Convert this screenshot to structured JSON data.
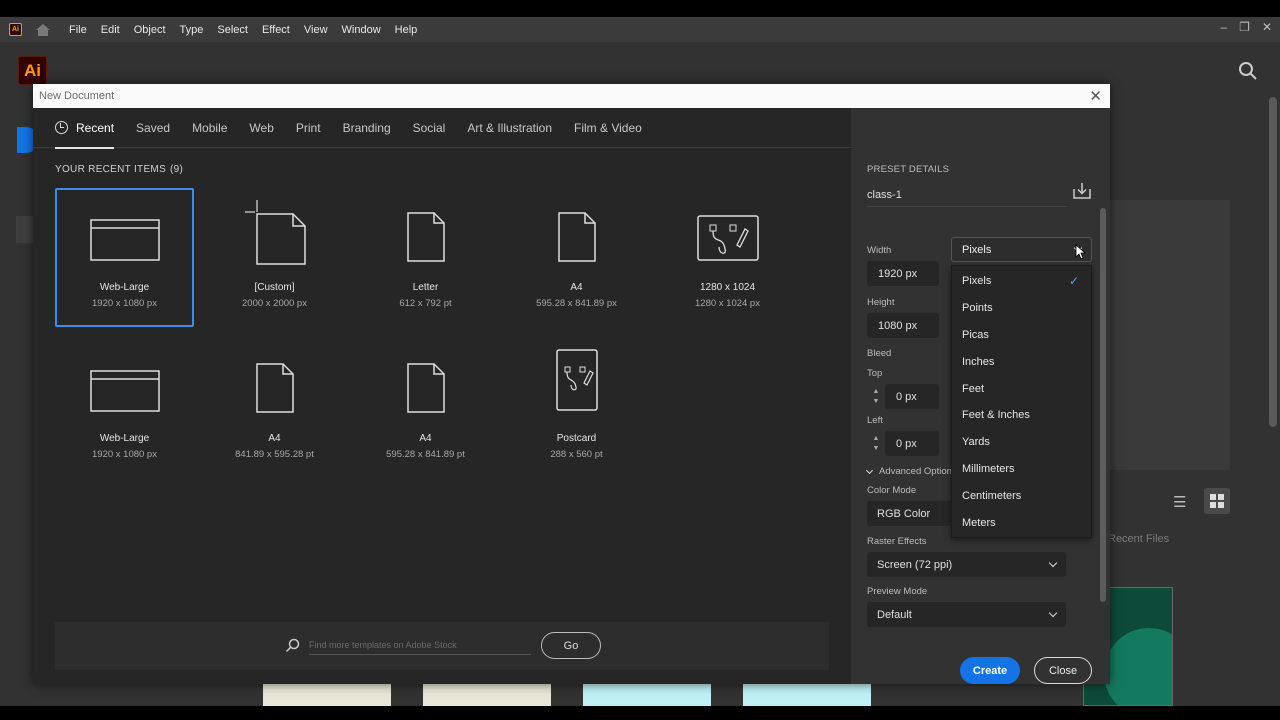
{
  "app": {
    "logo_small": "Ai",
    "logo_large": "Ai",
    "menu": [
      "File",
      "Edit",
      "Object",
      "Type",
      "Select",
      "Effect",
      "View",
      "Window",
      "Help"
    ],
    "window_controls": [
      "–",
      "❐",
      "✕"
    ],
    "background_recent_label": "Recent Files"
  },
  "dialog": {
    "title": "New Document",
    "close_glyph": "✕",
    "tabs": [
      {
        "label": "Recent",
        "active": true
      },
      {
        "label": "Saved"
      },
      {
        "label": "Mobile"
      },
      {
        "label": "Web"
      },
      {
        "label": "Print"
      },
      {
        "label": "Branding"
      },
      {
        "label": "Social"
      },
      {
        "label": "Art & Illustration"
      },
      {
        "label": "Film & Video"
      }
    ],
    "recent_header": "YOUR RECENT ITEMS",
    "recent_count": "(9)",
    "items": [
      {
        "name": "Web-Large",
        "size": "1920 x 1080 px",
        "icon": "web-icon",
        "selected": true
      },
      {
        "name": "[Custom]",
        "size": "2000 x 2000 px",
        "icon": "custom-document-icon"
      },
      {
        "name": "Letter",
        "size": "612 x 792 pt",
        "icon": "document-icon"
      },
      {
        "name": "A4",
        "size": "595.28 x 841.89 px",
        "icon": "document-icon"
      },
      {
        "name": "1280 x 1024",
        "size": "1280 x 1024 px",
        "icon": "art-icon"
      },
      {
        "name": "Web-Large",
        "size": "1920 x 1080 px",
        "icon": "web-icon"
      },
      {
        "name": "A4",
        "size": "841.89 x 595.28 pt",
        "icon": "document-icon"
      },
      {
        "name": "A4",
        "size": "595.28 x 841.89 pt",
        "icon": "document-icon"
      },
      {
        "name": "Postcard",
        "size": "288 x 560 pt",
        "icon": "art-icon"
      }
    ],
    "search_placeholder": "Find more templates on Adobe Stock",
    "go_label": "Go",
    "preset": {
      "header": "PRESET DETAILS",
      "name": "class-1",
      "width_label": "Width",
      "width_value": "1920 px",
      "units_value": "Pixels",
      "height_label": "Height",
      "height_value": "1080 px",
      "bleed_label": "Bleed",
      "top_label": "Top",
      "top_value": "0 px",
      "left_label": "Left",
      "left_value": "0 px",
      "advanced_label": "Advanced Options",
      "color_mode_label": "Color Mode",
      "color_mode_value": "RGB Color",
      "raster_label": "Raster Effects",
      "raster_value": "Screen (72 ppi)",
      "preview_label": "Preview Mode",
      "preview_value": "Default"
    },
    "units_options": [
      "Pixels",
      "Points",
      "Picas",
      "Inches",
      "Feet",
      "Feet & Inches",
      "Yards",
      "Millimeters",
      "Centimeters",
      "Meters"
    ],
    "units_selected": "Pixels",
    "create_label": "Create",
    "close_label": "Close"
  },
  "colors": {
    "accent": "#1473e6",
    "selection_border": "#378ef0",
    "dialog_left_bg": "#262626",
    "dialog_right_bg": "#323232"
  }
}
